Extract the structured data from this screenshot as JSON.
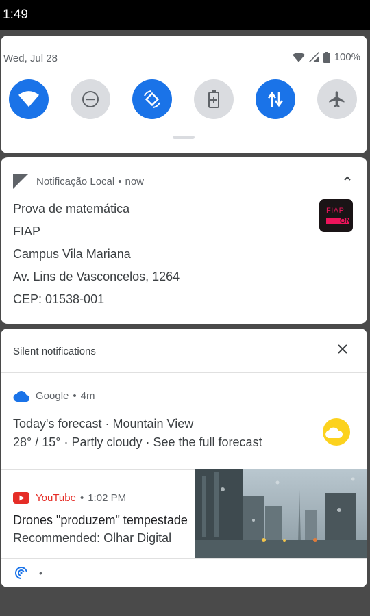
{
  "statusbar": {
    "time": "1:49"
  },
  "quick_settings": {
    "date": "Wed, Jul 28",
    "battery": "100%",
    "tiles": [
      {
        "name": "wifi",
        "state": "on"
      },
      {
        "name": "do-not-disturb",
        "state": "off"
      },
      {
        "name": "auto-rotate",
        "state": "on"
      },
      {
        "name": "battery-saver",
        "state": "off"
      },
      {
        "name": "mobile-data",
        "state": "on"
      },
      {
        "name": "airplane-mode",
        "state": "off"
      }
    ]
  },
  "local_notification": {
    "app": "Notificação Local",
    "time": "now",
    "lines": [
      "Prova de matemática",
      "FIAP",
      "Campus Vila Mariana",
      "Av. Lins de Vasconcelos, 1264",
      "CEP: 01538-001"
    ],
    "logo_text": "FIAP ON"
  },
  "silent": {
    "title": "Silent notifications",
    "google": {
      "app": "Google",
      "time": "4m",
      "line1": "Today's forecast · Mountain View",
      "line2": "28° / 15° · Partly cloudy · See the full forecast"
    },
    "youtube": {
      "app": "YouTube",
      "time": "1:02 PM",
      "title": "Drones \"produzem\" tempestade de chuva em Dubai",
      "subtitle": "Recommended: Olhar Digital"
    }
  },
  "colors": {
    "accent": "#1a73e8",
    "youtube": "#e52d27",
    "fiap": "#ed145b"
  }
}
